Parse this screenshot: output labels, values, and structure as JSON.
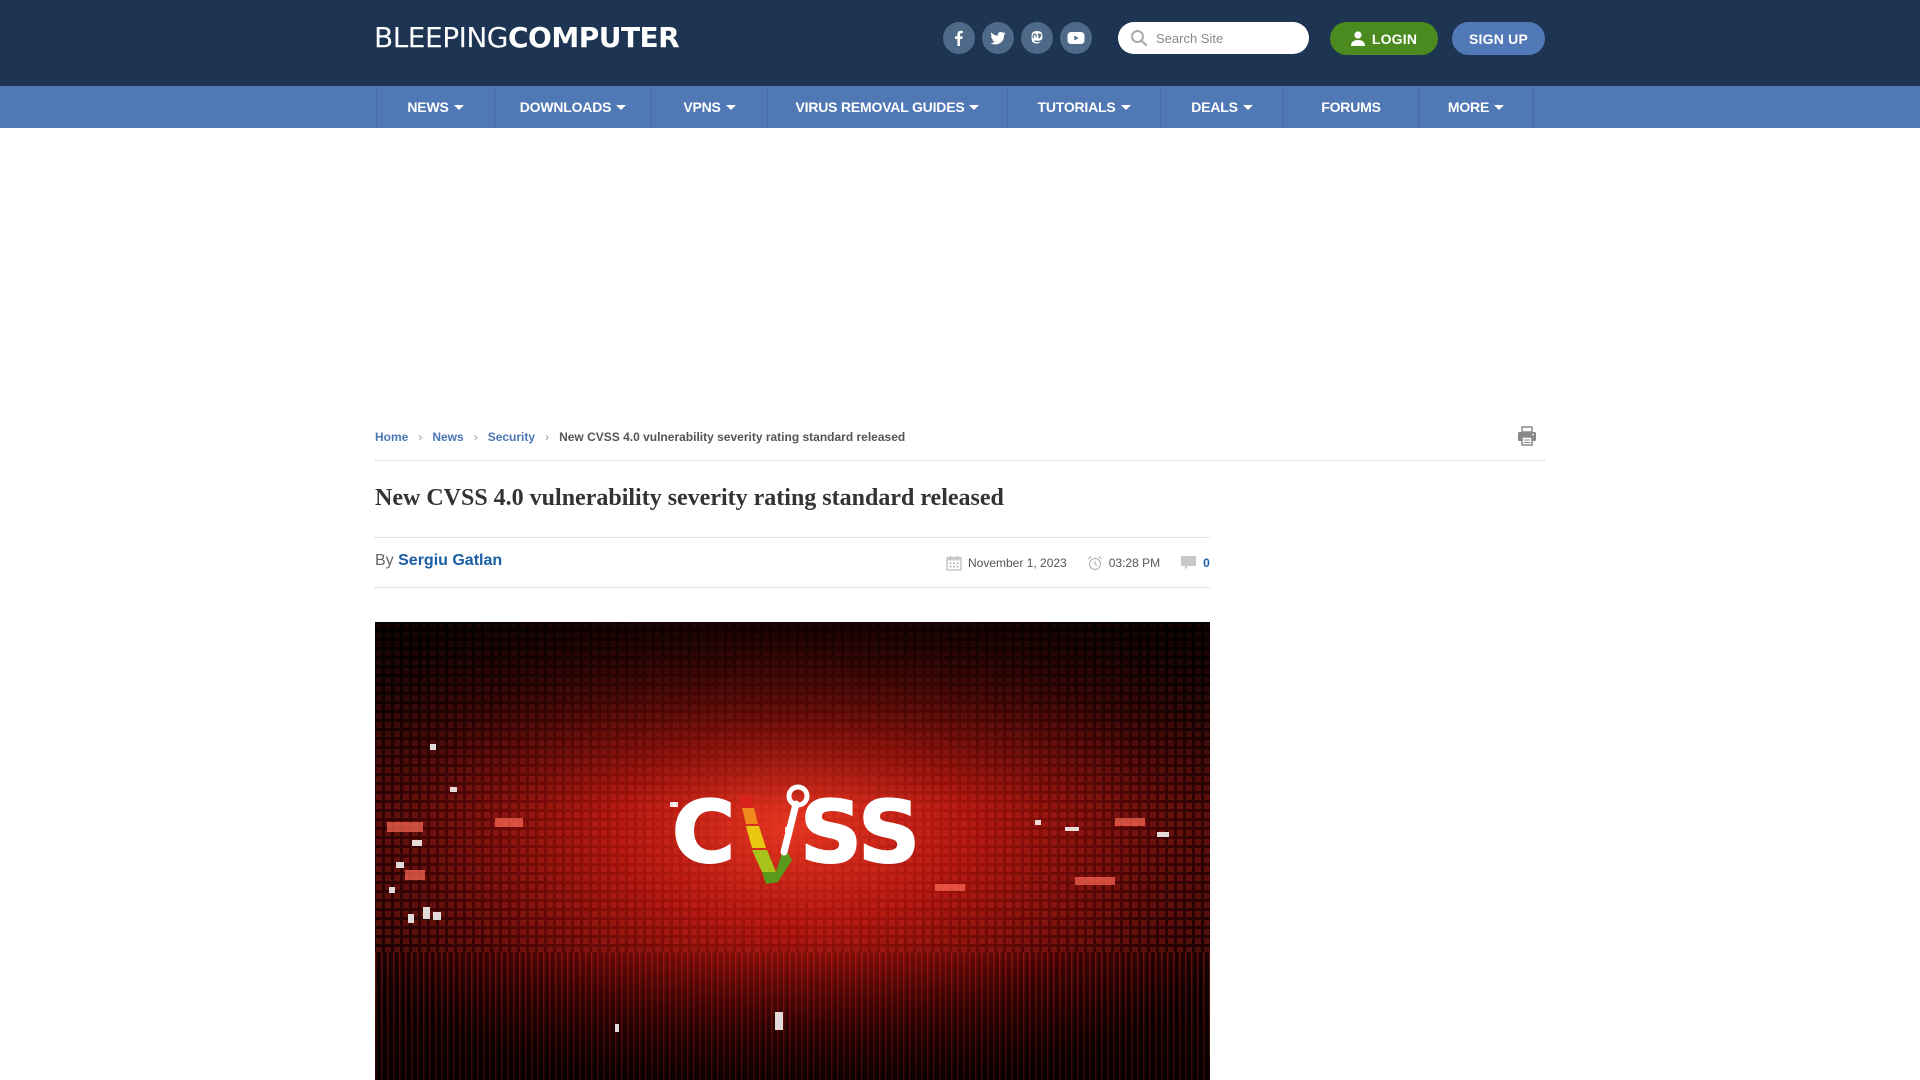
{
  "header": {
    "logo": {
      "thin": "BLEEPING",
      "bold": "COMPUTER"
    },
    "social": [
      {
        "name": "facebook",
        "icon": "facebook-icon"
      },
      {
        "name": "twitter",
        "icon": "twitter-icon"
      },
      {
        "name": "mastodon",
        "icon": "mastodon-icon"
      },
      {
        "name": "youtube",
        "icon": "youtube-icon"
      }
    ],
    "search": {
      "placeholder": "Search Site",
      "value": "",
      "icon": "search-icon"
    },
    "login_label": "LOGIN",
    "signup_label": "SIGN UP"
  },
  "nav": {
    "items": [
      {
        "label": "NEWS",
        "dropdown": true
      },
      {
        "label": "DOWNLOADS",
        "dropdown": true
      },
      {
        "label": "VPNS",
        "dropdown": true
      },
      {
        "label": "VIRUS REMOVAL GUIDES",
        "dropdown": true
      },
      {
        "label": "TUTORIALS",
        "dropdown": true
      },
      {
        "label": "DEALS",
        "dropdown": true
      },
      {
        "label": "FORUMS",
        "dropdown": false
      },
      {
        "label": "MORE",
        "dropdown": true
      }
    ]
  },
  "breadcrumb": {
    "items": [
      "Home",
      "News",
      "Security"
    ],
    "current": "New CVSS 4.0 vulnerability severity rating standard released"
  },
  "article": {
    "title": "New CVSS 4.0 vulnerability severity rating standard released",
    "by_label": "By",
    "author": "Sergiu Gatlan",
    "date": "November 1, 2023",
    "time": "03:28 PM",
    "comment_count": "0",
    "hero_image": {
      "alt": "CVSS",
      "logo_text": "CVSS"
    }
  },
  "colors": {
    "header_bg": "#1d3553",
    "nav_bg": "#5078b5",
    "login_green": "#4a8a1f",
    "signup_blue": "#5279b7",
    "link_blue": "#1a5ea6"
  }
}
